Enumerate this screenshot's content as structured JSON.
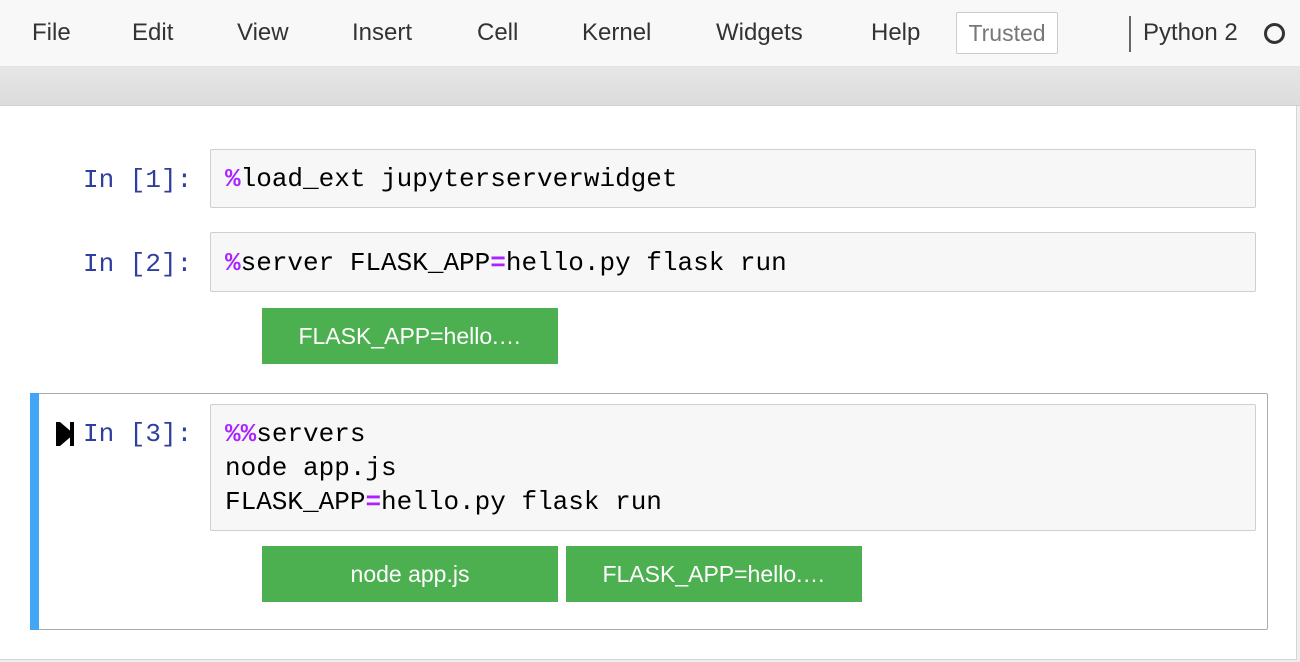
{
  "menu": {
    "items": [
      "File",
      "Edit",
      "View",
      "Insert",
      "Cell",
      "Kernel",
      "Widgets",
      "Help"
    ],
    "trusted_label": "Trusted",
    "kernel_name": "Python 2",
    "kernel_indicator_icon": "circle-outline-icon"
  },
  "cells": [
    {
      "prompt": "In [1]:",
      "lines": [
        [
          {
            "t": "%",
            "c": "magic"
          },
          {
            "t": "load_ext jupyterserverwidget",
            "c": ""
          }
        ]
      ],
      "widgets": []
    },
    {
      "prompt": "In [2]:",
      "lines": [
        [
          {
            "t": "%",
            "c": "magic"
          },
          {
            "t": "server FLASK_APP",
            "c": ""
          },
          {
            "t": "=",
            "c": "op"
          },
          {
            "t": "hello.py flask run",
            "c": ""
          }
        ]
      ],
      "widgets": [
        "FLASK_APP=hello.…"
      ]
    },
    {
      "prompt": "In [3]:",
      "lines": [
        [
          {
            "t": "%%",
            "c": "magic"
          },
          {
            "t": "servers",
            "c": ""
          }
        ],
        [
          {
            "t": "node app.js",
            "c": ""
          }
        ],
        [
          {
            "t": "FLASK_APP",
            "c": ""
          },
          {
            "t": "=",
            "c": "op"
          },
          {
            "t": "hello.py flask run",
            "c": ""
          }
        ]
      ],
      "widgets": [
        "node app.js",
        "FLASK_APP=hello.…"
      ]
    }
  ],
  "colors": {
    "prompt": "#303f9f",
    "magic": "#aa22ff",
    "widget_button": "#4caf50",
    "selected_cell_bar": "#42a5f5"
  },
  "icons": {
    "run_marker": "step-forward-icon"
  }
}
